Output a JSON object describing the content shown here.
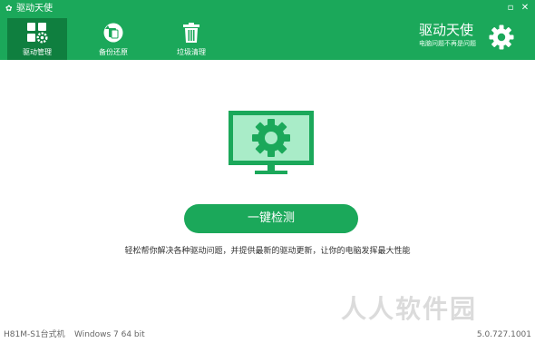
{
  "window": {
    "title": "驱动天使",
    "controls": {
      "minimize": "▫",
      "close": "✕"
    }
  },
  "tabs": [
    {
      "label": "驱动管理",
      "icon": "driver-manage-icon",
      "active": true
    },
    {
      "label": "备份还原",
      "icon": "backup-restore-icon",
      "active": false
    },
    {
      "label": "垃圾清理",
      "icon": "trash-icon",
      "active": false
    }
  ],
  "brand": {
    "title": "驱动天使",
    "slogan": "电脑问题不再是问题",
    "icon": "gear-icon"
  },
  "main": {
    "scan_button": "一键检测",
    "description": "轻松帮你解决各种驱动问题，并提供最新的驱动更新，让你的电脑发挥最大性能"
  },
  "status": {
    "model": "H81M-S1台式机",
    "os": "Windows 7 64 bit",
    "version": "5.0.727.1001"
  },
  "watermark": "人人软件园",
  "colors": {
    "accent": "#1ba85a",
    "active_tab": "#0f7f3f",
    "monitor_screen": "#a9ecc8"
  }
}
